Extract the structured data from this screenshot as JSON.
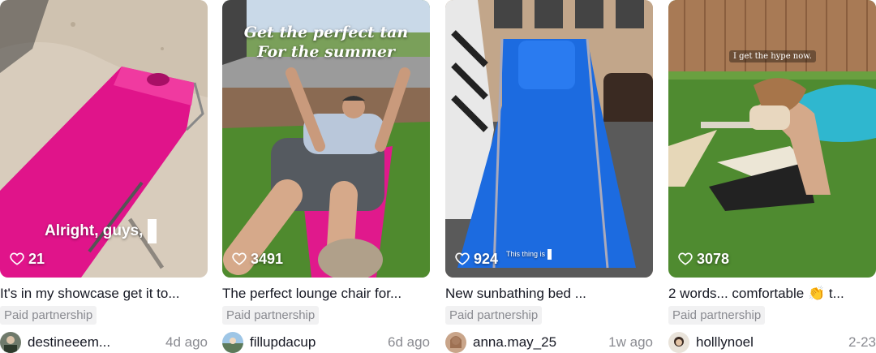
{
  "videos": [
    {
      "title": "It's in my showcase get it to...",
      "badge": "Paid partnership",
      "username": "destineeem...",
      "date": "4d ago",
      "likes": "21",
      "overlay_caption": "Alright, guys,"
    },
    {
      "title": "The perfect lounge chair for...",
      "badge": "Paid partnership",
      "username": "fillupdacup",
      "date": "6d ago",
      "likes": "3491",
      "overlay_line1": "Get the perfect tan",
      "overlay_line2": "For the summer"
    },
    {
      "title": "New sunbathing bed ...",
      "badge": "Paid partnership",
      "username": "anna.may_25",
      "date": "1w ago",
      "likes": "924",
      "overlay_caption": "This thing is"
    },
    {
      "title": "2 words... comfortable 👏 t...",
      "badge": "Paid partnership",
      "username": "holllynoel",
      "date": "2-23",
      "likes": "3078",
      "overlay_caption": "I get the hype now."
    }
  ],
  "colors": {
    "text": "#161823",
    "muted": "#8a8b91",
    "badge_bg": "#f1f1f2"
  },
  "icons": [
    "heart-outline-icon",
    "avatar"
  ]
}
